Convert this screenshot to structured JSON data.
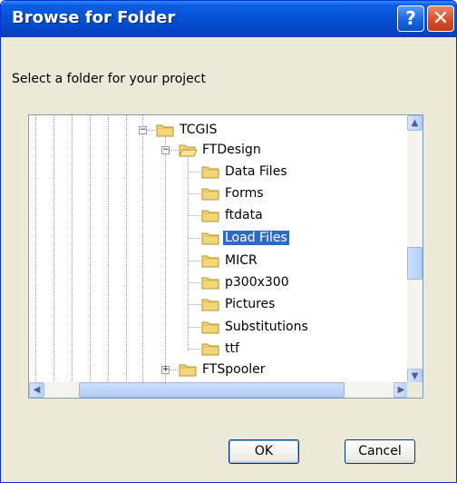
{
  "window": {
    "title": "Browse for Folder",
    "help_label": "?",
    "close_label": "✕"
  },
  "prompt": "Select a folder for your project",
  "tree": {
    "items": [
      {
        "label": "TCGIS",
        "expander": "−",
        "selected": false
      },
      {
        "label": "FTDesign",
        "expander": "−",
        "selected": false
      },
      {
        "label": "Data Files",
        "selected": false
      },
      {
        "label": "Forms",
        "selected": false
      },
      {
        "label": "ftdata",
        "selected": false
      },
      {
        "label": "Load Files",
        "selected": true
      },
      {
        "label": "MICR",
        "selected": false
      },
      {
        "label": "p300x300",
        "selected": false
      },
      {
        "label": "Pictures",
        "selected": false
      },
      {
        "label": "Substitutions",
        "selected": false
      },
      {
        "label": "ttf",
        "selected": false
      },
      {
        "label": "FTSpooler",
        "expander": "+",
        "selected": false
      }
    ]
  },
  "scrollbar": {
    "up_arrow": "▲",
    "down_arrow": "▼",
    "left_arrow": "◀",
    "right_arrow": "▶"
  },
  "buttons": {
    "ok": "OK",
    "cancel": "Cancel"
  },
  "colors": {
    "title_bar": "#0552d6",
    "selection": "#316ac5",
    "dialog_bg": "#ece9d8"
  }
}
